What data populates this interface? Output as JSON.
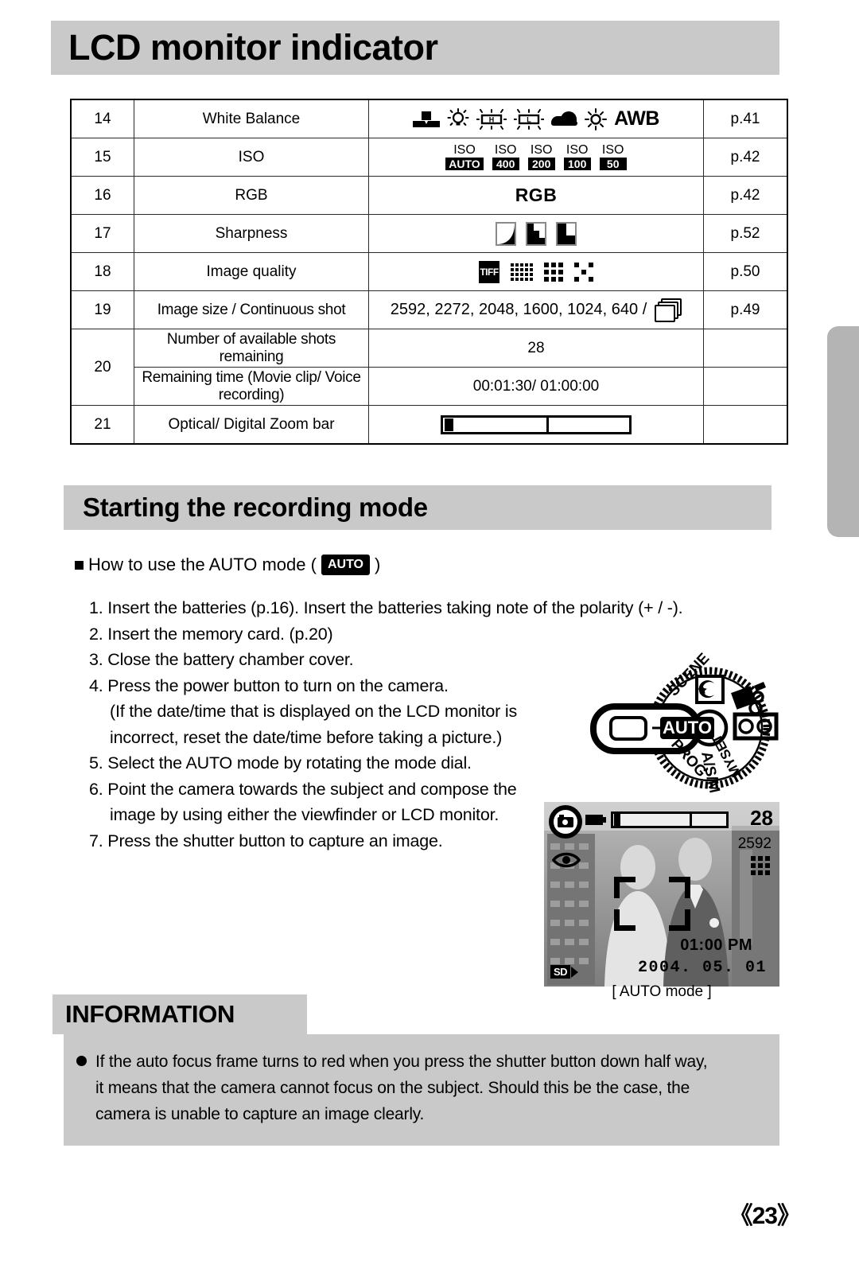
{
  "page": {
    "title": "LCD monitor indicator",
    "number": "《23》"
  },
  "indicator_table": {
    "rows": [
      {
        "no": "14",
        "name": "White Balance",
        "icons": "custom / incandescent / fluorescent-H / fluorescent-L / cloudy / daylight / AWB",
        "page": "p.41"
      },
      {
        "no": "15",
        "name": "ISO",
        "icons": "ISO AUTO / ISO 400 / ISO 200 / ISO 100 / ISO 50",
        "page": "p.42"
      },
      {
        "no": "16",
        "name": "RGB",
        "icons": "RGB",
        "page": "p.42"
      },
      {
        "no": "17",
        "name": "Sharpness",
        "icons": "soft / normal / vivid",
        "page": "p.52"
      },
      {
        "no": "18",
        "name": "Image quality",
        "icons": "TIFF / fine / normal / economy",
        "page": "p.50"
      },
      {
        "no": "19",
        "name": "Image size / Continuous shot",
        "icons": "2592, 2272, 2048, 1600, 1024, 640 /",
        "page": "p.49"
      },
      {
        "no": "20",
        "name": "Number of available shots remaining",
        "icons": "28",
        "page": ""
      },
      {
        "no": "",
        "name": "Remaining time (Movie clip/ Voice recording)",
        "icons": "00:01:30/ 01:00:00",
        "page": ""
      },
      {
        "no": "21",
        "name": "Optical/ Digital Zoom bar",
        "icons": "zoom-bar",
        "page": ""
      }
    ],
    "wb_awb_label": "AWB",
    "wb_fluor_h": "H",
    "wb_fluor_l": "L",
    "iso_items": [
      {
        "top": "ISO",
        "value": "AUTO"
      },
      {
        "top": "ISO",
        "value": "400"
      },
      {
        "top": "ISO",
        "value": "200"
      },
      {
        "top": "ISO",
        "value": "100"
      },
      {
        "top": "ISO",
        "value": "50"
      }
    ],
    "rgb_label": "RGB",
    "tiff_label": "TIFF",
    "image_sizes": "2592, 2272, 2048, 1600, 1024, 640 /",
    "shots_remaining": "28",
    "remaining_time": "00:01:30/ 01:00:00"
  },
  "section": {
    "heading": "Starting the recording mode",
    "sub_heading_prefix": "How to use the AUTO mode (",
    "sub_heading_chip": "AUTO",
    "sub_heading_suffix": ")",
    "steps": [
      "1. Insert the batteries (p.16).  Insert the batteries taking note of the polarity (+ / -).",
      "2. Insert the memory card. (p.20)",
      "3. Close the battery chamber cover.",
      "4. Press the power button to turn on the camera.",
      "(If the date/time that is displayed on the LCD monitor is",
      "incorrect, reset the date/time before taking a picture.)",
      "5. Select the AUTO mode by rotating the mode dial.",
      "6. Point the camera towards the subject and compose the",
      "image by using either the viewfinder or LCD monitor.",
      "7. Press the shutter button to capture an image."
    ]
  },
  "mode_dial": {
    "auto_label": "AUTO",
    "scene_label": "SCENE",
    "prog_label": "PROG",
    "asm_label": "A/S/M",
    "myset_label": "MYSET",
    "night_icon": "night-scene-icon",
    "movie_icon": "movie-clip-icon",
    "voice_icon": "voice-recording-icon"
  },
  "lcd_preview": {
    "shots": "28",
    "size": "2592",
    "time": "01:00 PM",
    "date": "2004. 05. 01",
    "card_label": "SD",
    "caption": "[ AUTO mode ]"
  },
  "information": {
    "heading": "INFORMATION",
    "lines": [
      "If the auto focus frame turns to red when you press the shutter button down half way,",
      "it means that the camera cannot focus on the subject. Should this be the case, the",
      "camera is unable to capture an image clearly."
    ]
  }
}
